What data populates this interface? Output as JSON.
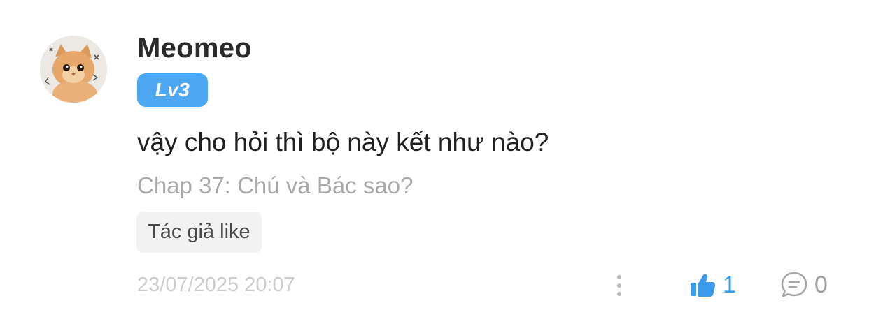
{
  "comment": {
    "avatar_icon": "kitten-avatar",
    "username": "Meomeo",
    "level_badge": "Lv3",
    "text": "vậy cho hỏi thì bộ này kết như nào?",
    "chapter": "Chap 37: Chú và Bác sao?",
    "author_tag": "Tác giả like",
    "timestamp": "23/07/2025 20:07",
    "likes": "1",
    "replies": "0"
  },
  "icons": {
    "more": "more-vertical-icon",
    "like": "thumbs-up-icon",
    "reply": "speech-bubble-icon"
  },
  "colors": {
    "badge": "#4da7f1",
    "like_accent": "#3b9ae9",
    "muted_text": "#a9a9a9"
  }
}
